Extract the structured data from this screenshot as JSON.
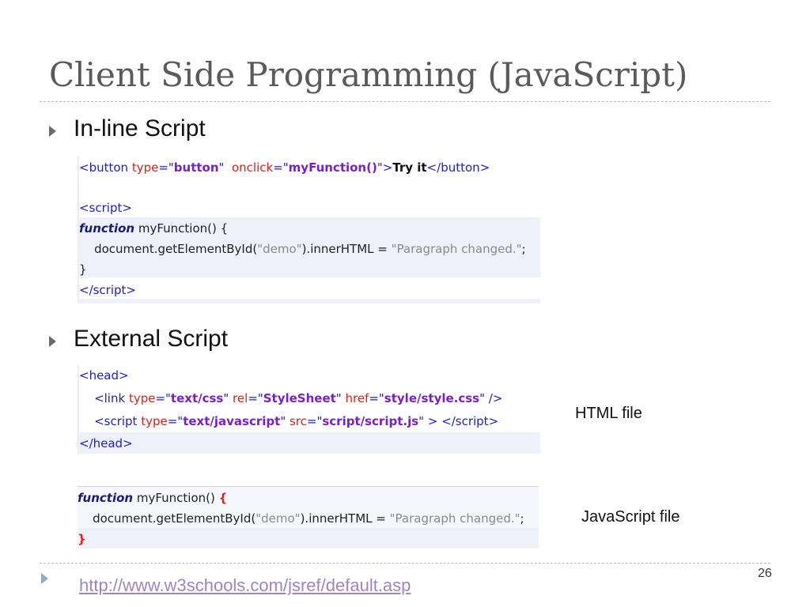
{
  "title": "Client Side Programming (JavaScript)",
  "bullets": [
    "In-line Script",
    "External Script"
  ],
  "code_inline": [
    [
      {
        "t": "<button ",
        "c": "tag"
      },
      {
        "t": "type",
        "c": "attr"
      },
      {
        "t": "=\"",
        "c": "tag"
      },
      {
        "t": "button",
        "c": "val"
      },
      {
        "t": "\"  ",
        "c": "tag"
      },
      {
        "t": "onclick",
        "c": "attr"
      },
      {
        "t": "=\"",
        "c": "tag"
      },
      {
        "t": "myFunction()",
        "c": "val"
      },
      {
        "t": "\">",
        "c": "tag"
      },
      {
        "t": "Try it",
        "c": "bold"
      },
      {
        "t": "</button>",
        "c": "tag"
      }
    ],
    [
      {
        "t": "<script>",
        "c": "tag"
      }
    ],
    [
      {
        "t": "function",
        "c": "kw"
      },
      {
        "t": " myFunction() {",
        "c": "plain"
      }
    ],
    [
      {
        "t": "    document.getElementById(",
        "c": "plain"
      },
      {
        "t": "\"demo\"",
        "c": "str"
      },
      {
        "t": ").innerHTML = ",
        "c": "plain"
      },
      {
        "t": "\"Paragraph changed.\"",
        "c": "str"
      },
      {
        "t": ";",
        "c": "plain"
      }
    ],
    [
      {
        "t": "}",
        "c": "plain"
      }
    ],
    [
      {
        "t": "</script>",
        "c": "tag"
      }
    ]
  ],
  "code_html": [
    [
      {
        "t": "<head>",
        "c": "tag"
      }
    ],
    [
      {
        "t": "    <link ",
        "c": "tag"
      },
      {
        "t": "type",
        "c": "attr"
      },
      {
        "t": "=\"",
        "c": "tag"
      },
      {
        "t": "text/css",
        "c": "val"
      },
      {
        "t": "\" ",
        "c": "tag"
      },
      {
        "t": "rel",
        "c": "attr"
      },
      {
        "t": "=\"",
        "c": "tag"
      },
      {
        "t": "StyleSheet",
        "c": "val"
      },
      {
        "t": "\" ",
        "c": "tag"
      },
      {
        "t": "href",
        "c": "attr"
      },
      {
        "t": "=\"",
        "c": "tag"
      },
      {
        "t": "style/style.css",
        "c": "val"
      },
      {
        "t": "\" />",
        "c": "tag"
      }
    ],
    [
      {
        "t": "    <script ",
        "c": "tag"
      },
      {
        "t": "type",
        "c": "attr"
      },
      {
        "t": "=\"",
        "c": "tag"
      },
      {
        "t": "text/javascript",
        "c": "val"
      },
      {
        "t": "\" ",
        "c": "tag"
      },
      {
        "t": "src",
        "c": "attr"
      },
      {
        "t": "=\"",
        "c": "tag"
      },
      {
        "t": "script/script.js",
        "c": "val"
      },
      {
        "t": "\" > </script>",
        "c": "tag"
      }
    ],
    [
      {
        "t": "</head>",
        "c": "tag"
      }
    ]
  ],
  "code_js": [
    [
      {
        "t": "function",
        "c": "kw"
      },
      {
        "t": " myFunction() ",
        "c": "plain"
      },
      {
        "t": "{",
        "c": "redb"
      }
    ],
    [
      {
        "t": "    document.getElementById(",
        "c": "plain"
      },
      {
        "t": "\"demo\"",
        "c": "str"
      },
      {
        "t": ").innerHTML = ",
        "c": "plain"
      },
      {
        "t": "\"Paragraph changed.\"",
        "c": "str"
      },
      {
        "t": ";",
        "c": "plain"
      }
    ],
    [
      {
        "t": "}",
        "c": "redb"
      }
    ]
  ],
  "labels": {
    "html_file": "HTML file",
    "js_file": "JavaScript file"
  },
  "link": "http://www.w3schools.com/jsref/default.asp",
  "page_number": "26"
}
